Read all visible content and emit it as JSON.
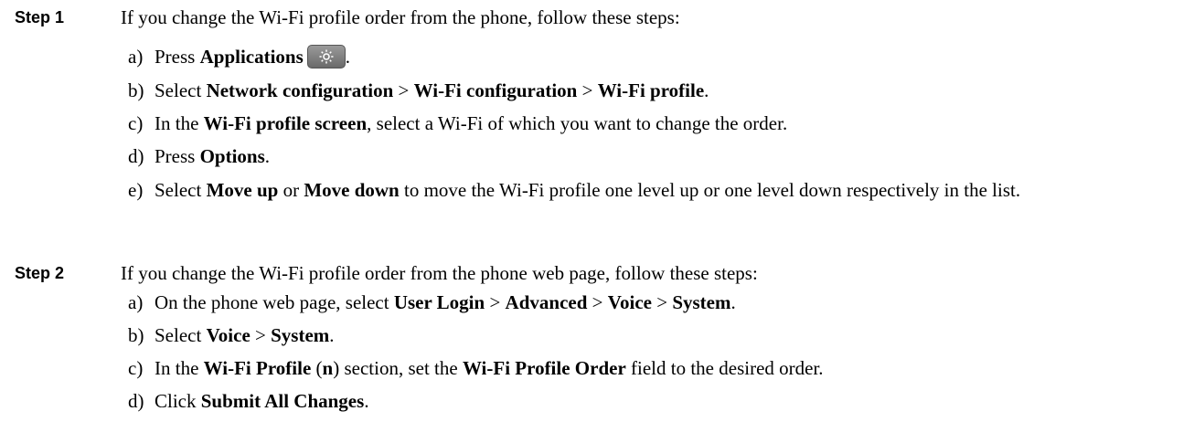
{
  "steps": [
    {
      "label": "Step 1",
      "intro": "If you change the Wi-Fi profile order from the phone, follow these steps:",
      "substeps": [
        {
          "letter": "a)",
          "t1": "Press ",
          "b1": "Applications",
          "t2": "."
        },
        {
          "letter": "b)",
          "t1": "Select ",
          "b1": "Network configuration",
          "t2": " > ",
          "b2": "Wi-Fi configuration",
          "t3": " > ",
          "b3": "Wi-Fi profile",
          "t4": "."
        },
        {
          "letter": "c)",
          "t1": "In the ",
          "b1": "Wi-Fi profile screen",
          "t2": ", select a Wi-Fi of which you want to change the order."
        },
        {
          "letter": "d)",
          "t1": "Press ",
          "b1": "Options",
          "t2": "."
        },
        {
          "letter": "e)",
          "t1": "Select ",
          "b1": "Move up",
          "t2": " or ",
          "b2": "Move down",
          "t3": " to move the Wi-Fi profile one level up or one level down respectively in the list."
        }
      ]
    },
    {
      "label": "Step 2",
      "intro": "If you change the Wi-Fi profile order from the phone web page, follow these steps:",
      "substeps": [
        {
          "letter": "a)",
          "t1": "On the phone web page, select ",
          "b1": "User Login",
          "t2": " > ",
          "b2": "Advanced",
          "t3": " > ",
          "b3": "Voice",
          "t4": " > ",
          "b4": "System",
          "t5": "."
        },
        {
          "letter": "b)",
          "t1": "Select ",
          "b1": "Voice",
          "t2": " > ",
          "b2": "System",
          "t3": "."
        },
        {
          "letter": "c)",
          "t1": "In the ",
          "b1": "Wi-Fi Profile",
          "t2": " (",
          "b2": "n",
          "t3": ") section, set the ",
          "b3": "Wi-Fi Profile Order",
          "t4": " field to the desired order."
        },
        {
          "letter": "d)",
          "t1": "Click ",
          "b1": "Submit All Changes",
          "t2": "."
        }
      ]
    }
  ],
  "icons": {
    "applications_key": "gear-icon"
  }
}
